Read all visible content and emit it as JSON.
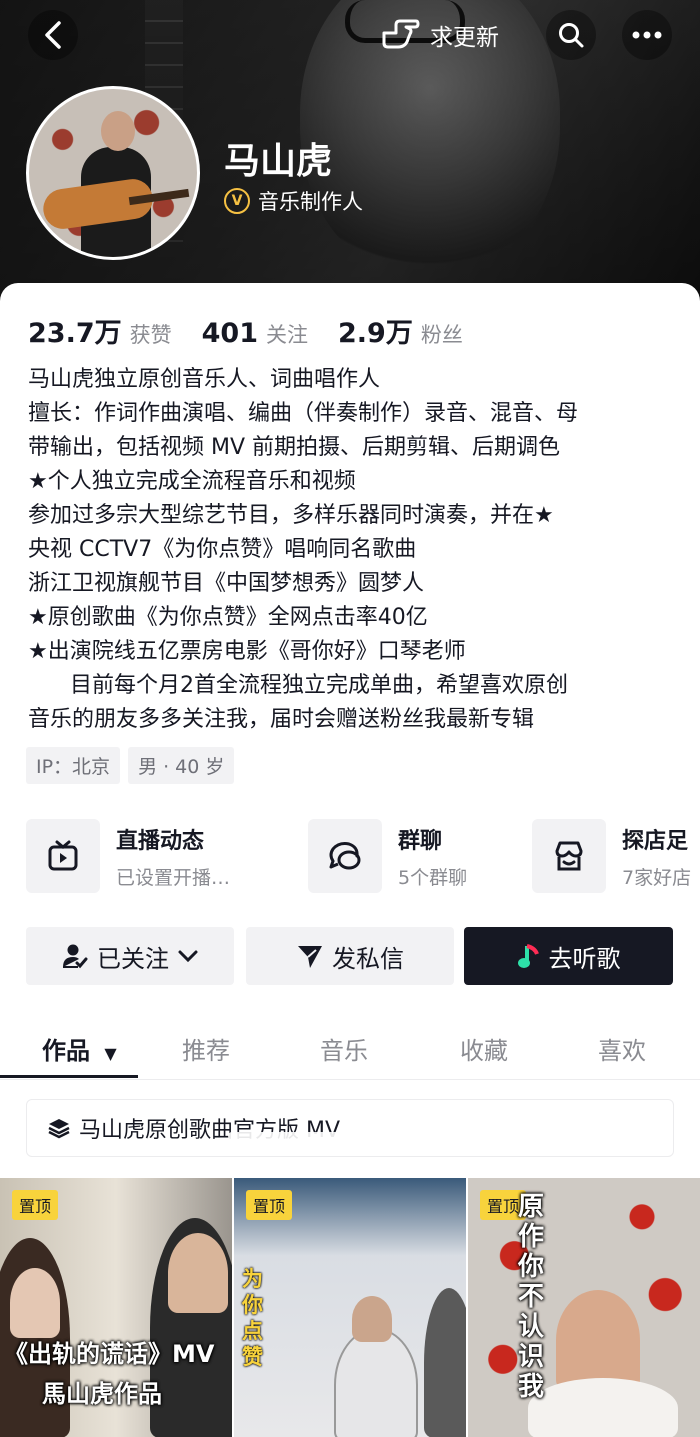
{
  "header": {
    "request_update_label": "求更新"
  },
  "profile": {
    "name": "马山虎",
    "role": "音乐制作人",
    "verified_icon_text": "V"
  },
  "stats": [
    {
      "value": "23.7万",
      "label": "获赞"
    },
    {
      "value": "401",
      "label": "关注"
    },
    {
      "value": "2.9万",
      "label": "粉丝"
    }
  ],
  "bio": [
    "马山虎独立原创音乐人、词曲唱作人",
    "擅长：作词作曲演唱、编曲（伴奏制作）录音、混音、母",
    "带输出，包括视频 MV 前期拍摄、后期剪辑、后期调色",
    "★个人独立完成全流程音乐和视频",
    "参加过多宗大型综艺节目，多样乐器同时演奏，并在★",
    "央视 CCTV7《为你点赞》唱响同名歌曲",
    "浙江卫视旗舰节目《中国梦想秀》圆梦人",
    "★原创歌曲《为你点赞》全网点击率40亿",
    "★出演院线五亿票房电影《哥你好》口琴老师",
    "      目前每个月2首全流程独立完成单曲，希望喜欢原创",
    "音乐的朋友多多关注我，届时会赠送粉丝我最新专辑"
  ],
  "tags": [
    "IP：北京",
    "男 · 40 岁"
  ],
  "features": [
    {
      "title": "直播动态",
      "subtitle": "已设置开播…",
      "icon": "tv-icon"
    },
    {
      "title": "群聊",
      "subtitle": "5个群聊",
      "icon": "chat-bubbles-icon"
    },
    {
      "title": "探店足",
      "subtitle": "7家好店",
      "icon": "shop-icon"
    }
  ],
  "actions": {
    "follow_label": "已关注",
    "message_label": "发私信",
    "listen_label": "去听歌"
  },
  "tabs": [
    "作品",
    "推荐",
    "音乐",
    "收藏",
    "喜欢"
  ],
  "collection_label": "马山虎原创歌曲官方版 MV",
  "videos": [
    {
      "pin": "置顶",
      "overlay_line1": "《出轨的谎话》MV",
      "overlay_line2": "馬山虎作品"
    },
    {
      "pin": "置顶",
      "overlay": "为你点赞"
    },
    {
      "pin": "置顶",
      "overlay": "原作你不认识我"
    }
  ],
  "colors": {
    "primary_text": "#161823",
    "secondary_text": "#8a8b91",
    "pin_badge": "#f8d33c",
    "verified": "#f6c143",
    "dark_button": "#161823"
  }
}
